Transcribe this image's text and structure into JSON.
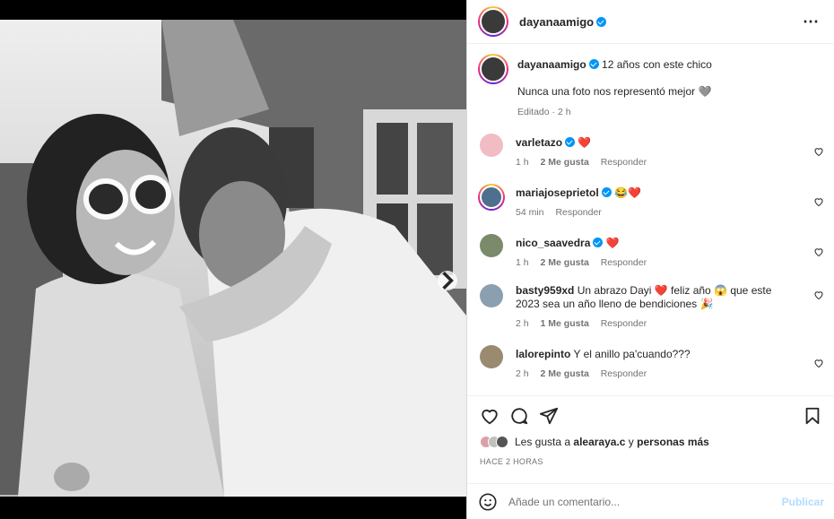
{
  "post": {
    "author": "dayanaamigo",
    "more_icon": "⋯"
  },
  "caption": {
    "username": "dayanaamigo",
    "text_line1": "12 años con este chico",
    "text_line2": "Nunca una foto nos representó mejor 🩶",
    "edited": "Editado · 2 h"
  },
  "comments": [
    {
      "username": "varletazo",
      "text": "❤️",
      "time": "1 h",
      "likes": "2 Me gusta",
      "reply": "Responder"
    },
    {
      "username": "mariajoseprietol",
      "text": "😂❤️",
      "time": "54 min",
      "likes": "",
      "reply": "Responder"
    },
    {
      "username": "nico_saavedra",
      "text": "❤️",
      "time": "1 h",
      "likes": "2 Me gusta",
      "reply": "Responder"
    },
    {
      "username": "basty959xd",
      "text": "Un abrazo Dayi ❤️ feliz año 😱 que este 2023 sea un año lleno de bendiciones 🎉",
      "time": "2 h",
      "likes": "1 Me gusta",
      "reply": "Responder"
    },
    {
      "username": "lalorepinto",
      "text": "Y el anillo pa'cuando???",
      "time": "2 h",
      "likes": "2 Me gusta",
      "reply": "Responder"
    }
  ],
  "likes_line": {
    "prefix": "Les gusta a",
    "user": "alearaya.c",
    "middle": "y",
    "others": "personas más"
  },
  "posted_ago": "HACE 2 HORAS",
  "comment_input": {
    "placeholder": "Añade un comentario...",
    "publish": "Publicar"
  },
  "icons": [
    "heart-icon",
    "comment-icon",
    "share-icon",
    "bookmark-icon",
    "emoji-icon",
    "chevron-right-icon",
    "verified-icon"
  ],
  "colors": {
    "accent": "#0095f6",
    "like_red": "#ed4956",
    "publish_disabled": "#b3dbff"
  }
}
